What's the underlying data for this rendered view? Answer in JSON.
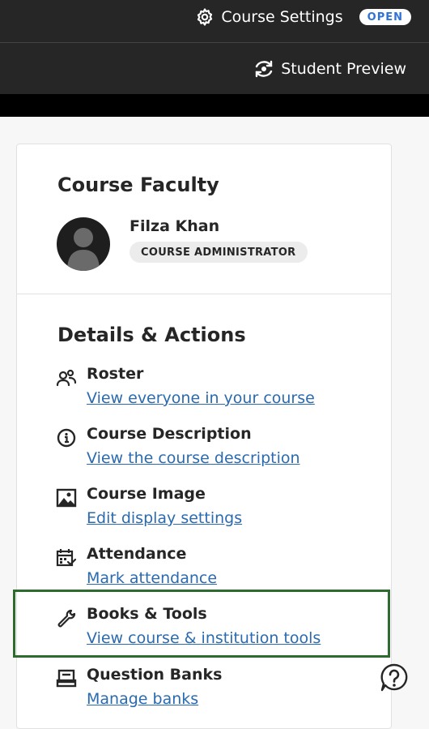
{
  "header": {
    "course_settings_label": "Course Settings",
    "status_badge": "OPEN",
    "student_preview_label": "Student Preview"
  },
  "faculty": {
    "title": "Course Faculty",
    "members": [
      {
        "name": "Filza Khan",
        "role": "COURSE ADMINISTRATOR"
      }
    ]
  },
  "details": {
    "title": "Details & Actions",
    "items": [
      {
        "icon": "roster-icon",
        "title": "Roster",
        "link": "View everyone in your course"
      },
      {
        "icon": "info-icon",
        "title": "Course Description",
        "link": "View the course description"
      },
      {
        "icon": "image-icon",
        "title": "Course Image",
        "link": "Edit display settings"
      },
      {
        "icon": "attendance-icon",
        "title": "Attendance",
        "link": "Mark attendance"
      },
      {
        "icon": "wrench-icon",
        "title": "Books & Tools",
        "link": "View course & institution tools"
      },
      {
        "icon": "question-bank-icon",
        "title": "Question Banks",
        "link": "Manage banks"
      }
    ]
  },
  "colors": {
    "header_bg": "#262626",
    "link": "#2a6ab0",
    "highlight_border": "#2e6b2e",
    "badge_text": "#2f73d6"
  }
}
